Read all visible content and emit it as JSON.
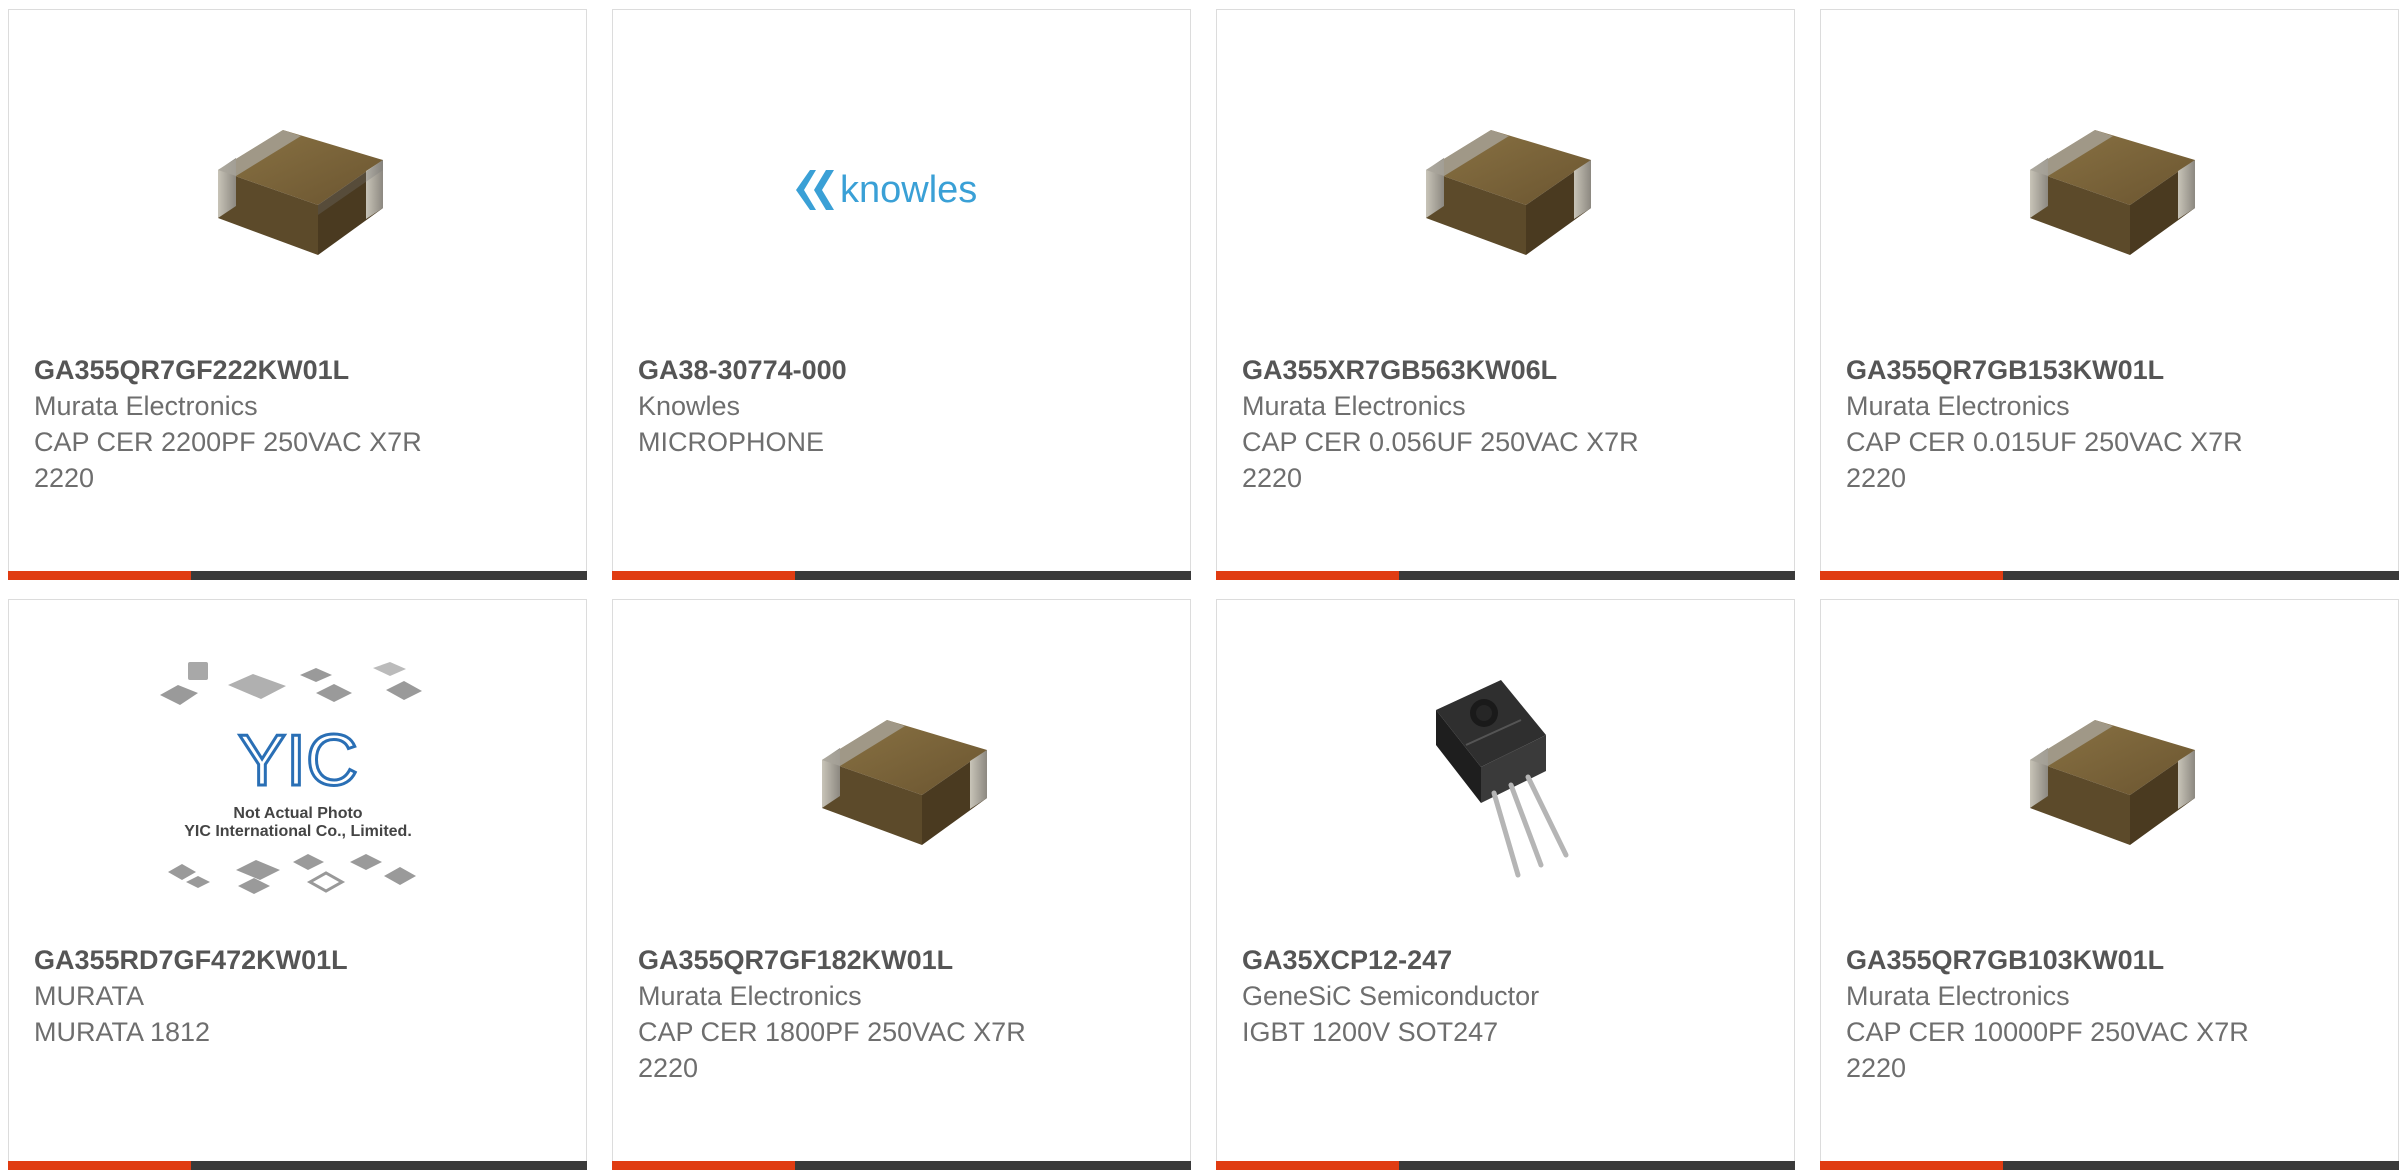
{
  "accent_color": "#e03c12",
  "bar_color": "#3a3a3a",
  "products": [
    {
      "part_number": "GA355QR7GF222KW01L",
      "manufacturer": "Murata Electronics",
      "description": "CAP CER 2200PF 250VAC X7R 2220",
      "image": "ceramic-capacitor"
    },
    {
      "part_number": "GA38-30774-000",
      "manufacturer": "Knowles",
      "description": "MICROPHONE",
      "image": "knowles-logo",
      "logo_text": "knowles"
    },
    {
      "part_number": "GA355XR7GB563KW06L",
      "manufacturer": "Murata Electronics",
      "description": "CAP CER 0.056UF 250VAC X7R 2220",
      "image": "ceramic-capacitor"
    },
    {
      "part_number": "GA355QR7GB153KW01L",
      "manufacturer": "Murata Electronics",
      "description": "CAP CER 0.015UF 250VAC X7R 2220",
      "image": "ceramic-capacitor"
    },
    {
      "part_number": "GA355RD7GF472KW01L",
      "manufacturer": "MURATA",
      "description": "MURATA 1812",
      "image": "yic-placeholder",
      "placeholder_line1": "Not Actual Photo",
      "placeholder_line2": "YIC International Co., Limited."
    },
    {
      "part_number": "GA355QR7GF182KW01L",
      "manufacturer": "Murata Electronics",
      "description": "CAP CER 1800PF 250VAC X7R 2220",
      "image": "ceramic-capacitor"
    },
    {
      "part_number": "GA35XCP12-247",
      "manufacturer": "GeneSiC Semiconductor",
      "description": "IGBT 1200V SOT247",
      "image": "to247-package"
    },
    {
      "part_number": "GA355QR7GB103KW01L",
      "manufacturer": "Murata Electronics",
      "description": "CAP CER 10000PF 250VAC X7R 2220",
      "image": "ceramic-capacitor"
    }
  ]
}
